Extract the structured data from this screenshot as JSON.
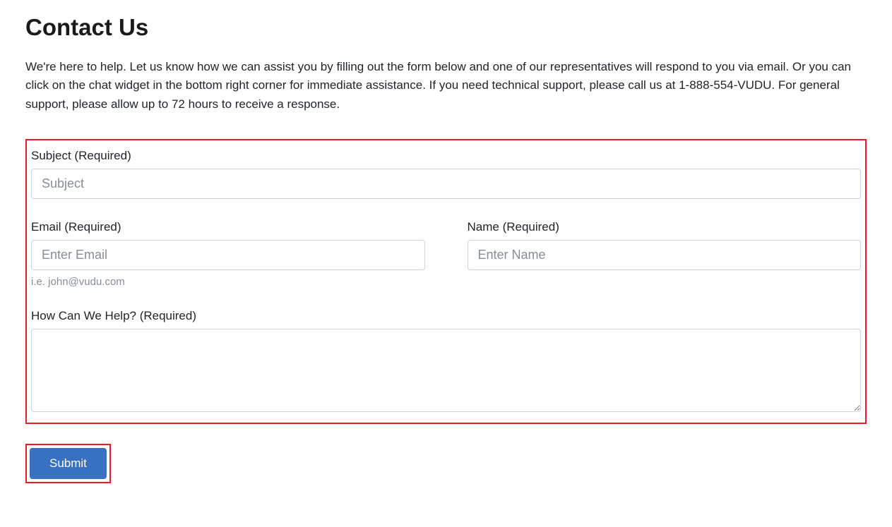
{
  "page": {
    "title": "Contact Us",
    "intro": "We're here to help. Let us know how we can assist you by filling out the form below and one of our representatives will respond to you via email. Or you can click on the chat widget in the bottom right corner for immediate assistance. If you need technical support, please call us at 1-888-554-VUDU. For general support, please allow up to 72 hours to receive a response."
  },
  "form": {
    "subject": {
      "label": "Subject (Required)",
      "placeholder": "Subject",
      "value": ""
    },
    "email": {
      "label": "Email (Required)",
      "placeholder": "Enter Email",
      "value": "",
      "help": "i.e. john@vudu.com"
    },
    "name": {
      "label": "Name (Required)",
      "placeholder": "Enter Name",
      "value": ""
    },
    "message": {
      "label": "How Can We Help? (Required)",
      "value": ""
    },
    "submit": {
      "label": "Submit"
    }
  }
}
